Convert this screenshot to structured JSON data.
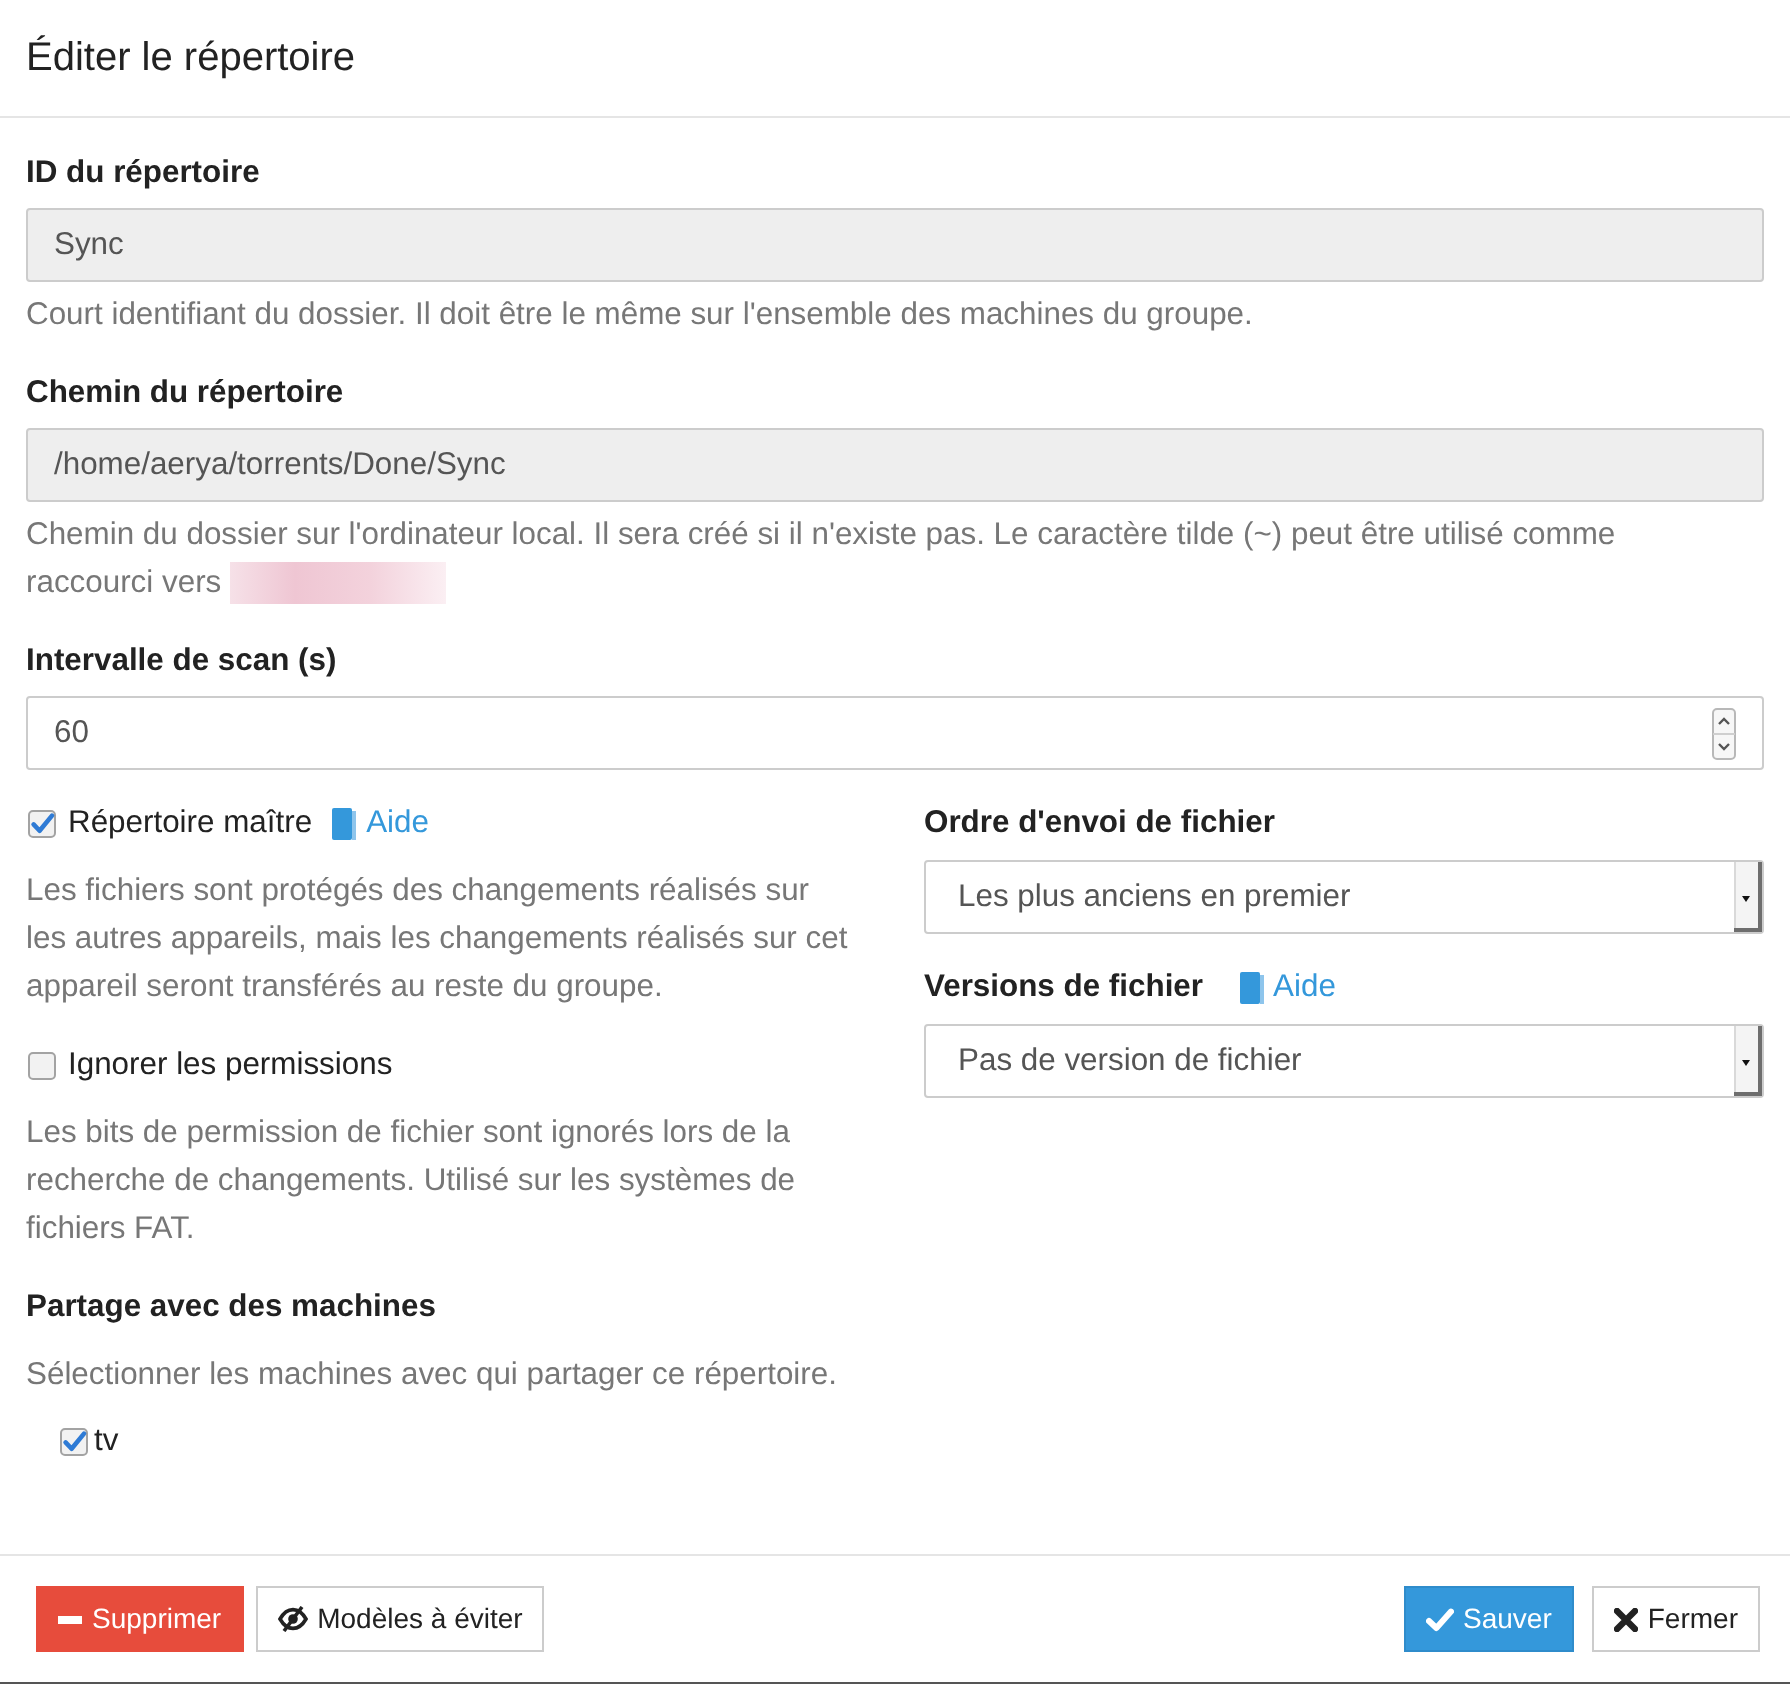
{
  "dialog": {
    "title": "Éditer le répertoire"
  },
  "fields": [
    {
      "kind": "text",
      "label": "ID du répertoire",
      "value": "Sync",
      "disabled": true,
      "help": "Court identifiant du dossier. Il doit être le même sur l'ensemble des machines du groupe."
    },
    {
      "kind": "text",
      "label": "Chemin du répertoire",
      "value": "/home/aerya/torrents/Done/Sync",
      "disabled": true,
      "help": "Chemin du dossier sur l'ordinateur local. Il sera créé si il n'existe pas. Le caractère tilde (~) peut être utilisé comme raccourci vers",
      "redacted": true
    },
    {
      "kind": "number",
      "label": "Intervalle de scan (s)",
      "value": "60",
      "disabled": false
    }
  ],
  "left_column": [
    {
      "kind": "checkbox",
      "label": "Répertoire maître",
      "checked": true,
      "help_link": "Aide",
      "help": "Les fichiers sont protégés des changements réalisés sur les autres appareils, mais les changements réalisés sur cet appareil seront transférés au reste du groupe."
    },
    {
      "kind": "checkbox",
      "label": "Ignorer les permissions",
      "checked": false,
      "help": "Les bits de permission de fichier sont ignorés lors de la recherche de changements. Utilisé sur les systèmes de fichiers FAT."
    },
    {
      "kind": "devices",
      "label": "Partage avec des machines",
      "help": "Sélectionner les machines avec qui partager ce répertoire.",
      "devices": [
        {
          "name": "tv",
          "checked": true
        }
      ]
    }
  ],
  "right_column": [
    {
      "kind": "select",
      "label": "Ordre d'envoi de fichier",
      "value": "Les plus anciens en premier"
    },
    {
      "kind": "select",
      "label": "Versions de fichier",
      "help_link": "Aide",
      "value": "Pas de version de fichier"
    }
  ],
  "footer": {
    "left_buttons": [
      {
        "kind": "delete",
        "label": "Supprimer"
      },
      {
        "kind": "patterns",
        "label": "Modèles à éviter"
      }
    ],
    "right_buttons": [
      {
        "kind": "save",
        "label": "Sauver"
      },
      {
        "kind": "close",
        "label": "Fermer"
      }
    ]
  }
}
